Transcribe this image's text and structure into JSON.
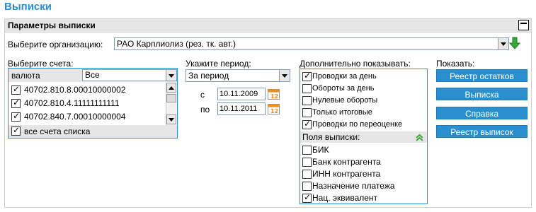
{
  "page_title": "Выписки",
  "panel": {
    "title": "Параметры выписки",
    "collapse_icon": "minus-box-icon"
  },
  "organization": {
    "label": "Выберите организацию:",
    "selected": "РАО Карплиолиз (рез. тк. авт.)",
    "go_icon": "green-down-arrow-icon"
  },
  "accounts": {
    "label": "Выберите счета:",
    "currency_label": "валюта",
    "currency_selected": "Все",
    "items": [
      {
        "number": "40702.810.8.00010000002",
        "checked": true
      },
      {
        "number": "40702.810.4.11111111111",
        "checked": true
      },
      {
        "number": "40702.840.7.00010000004",
        "checked": true
      }
    ],
    "all_label": "все счета списка",
    "all_checked": true
  },
  "period": {
    "label": "Укажите период:",
    "selected": "За период",
    "from_label": "с",
    "from_date": "10.11.2009",
    "to_label": "по",
    "to_date": "10.11.2011",
    "calendar_number": "12"
  },
  "extra": {
    "label": "Дополнительно показывать:",
    "items": [
      {
        "label": "Проводки за день",
        "checked": true
      },
      {
        "label": "Обороты за день",
        "checked": false
      },
      {
        "label": "Нулевые обороты",
        "checked": false
      },
      {
        "label": "Только итоговые",
        "checked": false
      },
      {
        "label": "Проводки по переоценке",
        "checked": true
      }
    ],
    "fields_header": "Поля выписки:",
    "fields": [
      {
        "label": "БИК",
        "checked": false
      },
      {
        "label": "Банк контрагента",
        "checked": false
      },
      {
        "label": "ИНН контрагента",
        "checked": false
      },
      {
        "label": "Назначение платежа",
        "checked": false
      },
      {
        "label": "Нац. эквивалент",
        "checked": true
      }
    ]
  },
  "show": {
    "label": "Показать:",
    "buttons": [
      "Реестр остатков",
      "Выписка",
      "Справка",
      "Реестр выписок"
    ]
  },
  "colors": {
    "accent": "#2a8fcf",
    "header_bg": "#e6e6e6",
    "go_green": "#3aa93a",
    "calendar_orange": "#f28c1c"
  }
}
